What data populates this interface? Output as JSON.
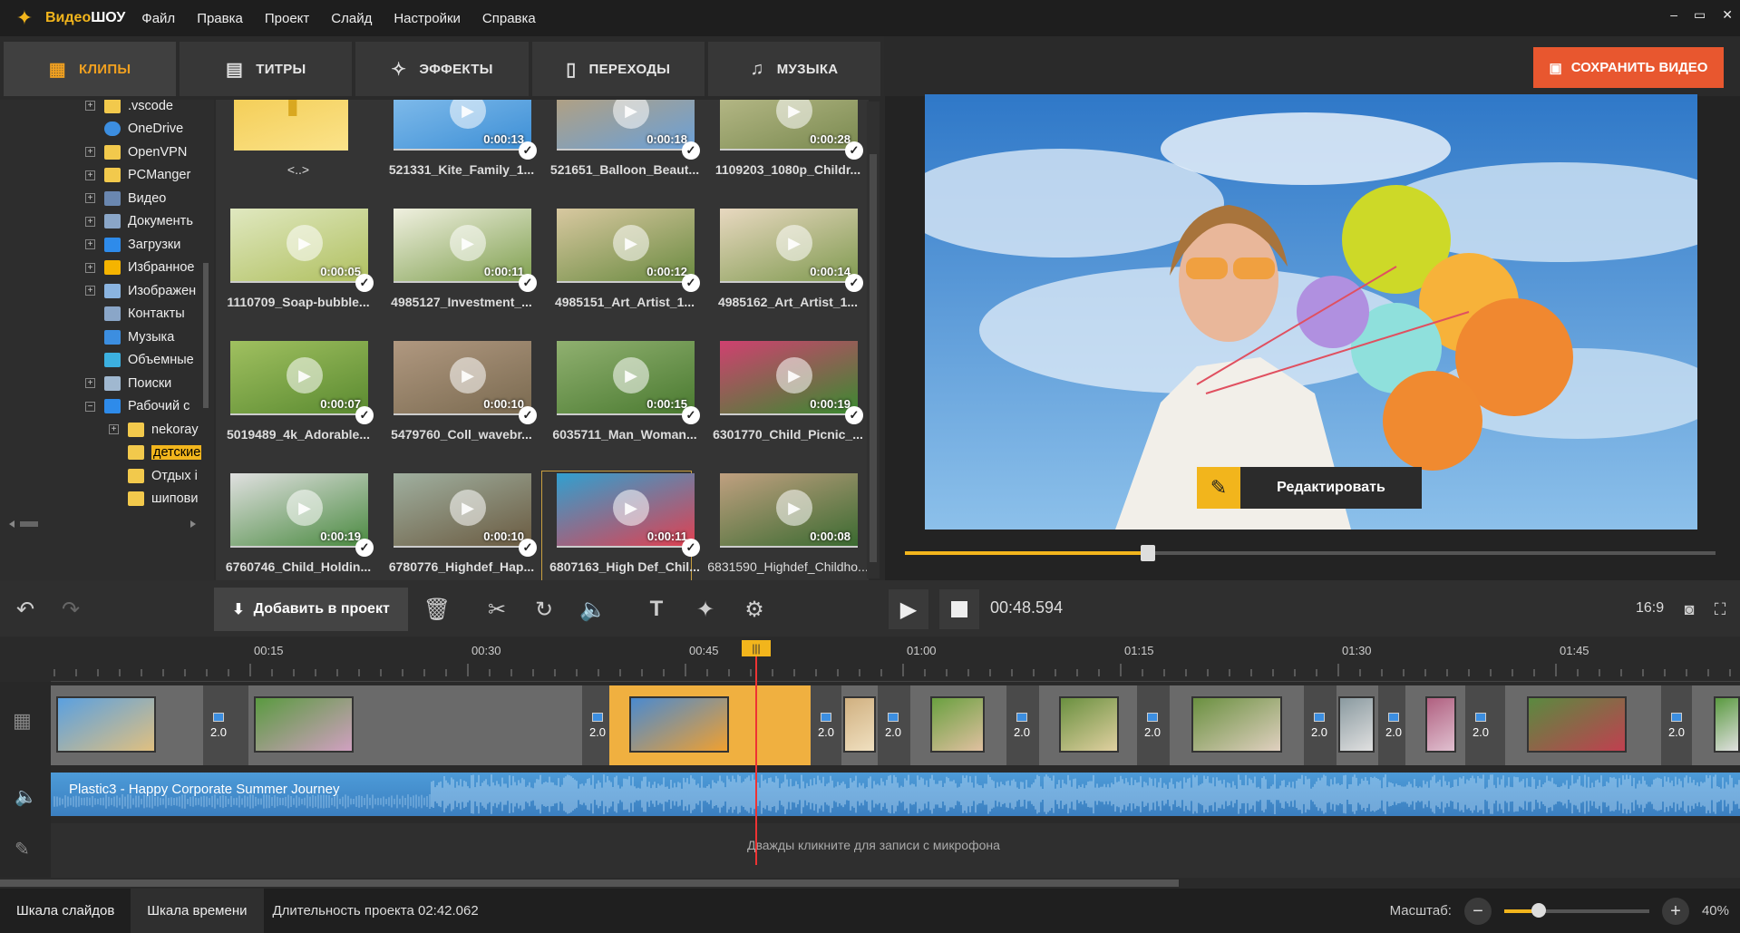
{
  "app": {
    "name_part1": "Видео",
    "name_part2": "ШОУ"
  },
  "menu": [
    "Файл",
    "Правка",
    "Проект",
    "Слайд",
    "Настройки",
    "Справка"
  ],
  "window_controls": [
    "–",
    "▭",
    "✕"
  ],
  "tabs": [
    {
      "label": "КЛИПЫ",
      "icon": "film-icon",
      "active": true
    },
    {
      "label": "ТИТРЫ",
      "icon": "text-bubble-icon",
      "active": false
    },
    {
      "label": "ЭФФЕКТЫ",
      "icon": "effects-icon",
      "active": false
    },
    {
      "label": "ПЕРЕХОДЫ",
      "icon": "transitions-icon",
      "active": false
    },
    {
      "label": "МУЗЫКА",
      "icon": "music-note-icon",
      "active": false
    }
  ],
  "save_button": {
    "label": "СОХРАНИТЬ ВИДЕО"
  },
  "tree": [
    {
      "label": ".vscode",
      "icon": "folder"
    },
    {
      "label": "OneDrive",
      "icon": "cloud"
    },
    {
      "label": "OpenVPN",
      "icon": "folder"
    },
    {
      "label": "PCManger",
      "icon": "folder"
    },
    {
      "label": "Видео",
      "icon": "video-folder"
    },
    {
      "label": "Документь",
      "icon": "document-folder"
    },
    {
      "label": "Загрузки",
      "icon": "download-folder"
    },
    {
      "label": "Избранное",
      "icon": "star-folder"
    },
    {
      "label": "Изображен",
      "icon": "image-folder"
    },
    {
      "label": "Контакты",
      "icon": "contacts-folder"
    },
    {
      "label": "Музыка",
      "icon": "music-folder"
    },
    {
      "label": "Объемные",
      "icon": "3d-folder"
    },
    {
      "label": "Поиски",
      "icon": "search-folder"
    },
    {
      "label": "Рабочий с",
      "icon": "desktop-folder"
    },
    {
      "label": "nekoray",
      "icon": "folder"
    },
    {
      "label": "детские",
      "icon": "folder",
      "selected": true
    },
    {
      "label": "Отдых і",
      "icon": "folder"
    },
    {
      "label": "шипови",
      "icon": "folder"
    }
  ],
  "clips": [
    {
      "name": "<..>",
      "duration": "",
      "folder_up": true
    },
    {
      "name": "521331_Kite_Family_1...",
      "duration": "0:00:13"
    },
    {
      "name": "521651_Balloon_Beaut...",
      "duration": "0:00:18"
    },
    {
      "name": "1109203_1080p_Childr...",
      "duration": "0:00:28"
    },
    {
      "name": "1110709_Soap-bubble...",
      "duration": "0:00:05"
    },
    {
      "name": "4985127_Investment_...",
      "duration": "0:00:11"
    },
    {
      "name": "4985151_Art_Artist_1...",
      "duration": "0:00:12"
    },
    {
      "name": "4985162_Art_Artist_1...",
      "duration": "0:00:14"
    },
    {
      "name": "5019489_4k_Adorable...",
      "duration": "0:00:07"
    },
    {
      "name": "5479760_Coll_wavebr...",
      "duration": "0:00:10"
    },
    {
      "name": "6035711_Man_Woman...",
      "duration": "0:00:15"
    },
    {
      "name": "6301770_Child_Picnic_...",
      "duration": "0:00:19"
    },
    {
      "name": "6760746_Child_Holdin...",
      "duration": "0:00:19"
    },
    {
      "name": "6780776_Highdef_Hap...",
      "duration": "0:00:10"
    },
    {
      "name": "6807163_High Def_Chil...",
      "duration": "0:00:11"
    },
    {
      "name": "6831590_Highdef_Childho...",
      "duration": "0:00:08"
    }
  ],
  "preview": {
    "edit_label": "Редактировать",
    "progress": 0.3
  },
  "toolbar": {
    "add_label": "Добавить в проект",
    "time": "00:48.594",
    "ratio": "16:9"
  },
  "ruler": [
    "00:15",
    "00:30",
    "00:45",
    "01:00",
    "01:15",
    "01:30",
    "01:45"
  ],
  "timeline": {
    "transition_value": "2.0",
    "audio_label": "Plastic3 - Happy Corporate Summer Journey",
    "mic_hint": "Дважды кликните для записи с микрофона"
  },
  "status": {
    "tab_slides": "Шкала слайдов",
    "tab_timeline": "Шкала времени",
    "duration": "Длительность проекта 02:42.062",
    "zoom_label": "Масштаб:",
    "zoom_value": "40%"
  },
  "colors": {
    "accent": "#f2b51c",
    "save": "#e8572f",
    "audio": "#4d9bd8"
  }
}
